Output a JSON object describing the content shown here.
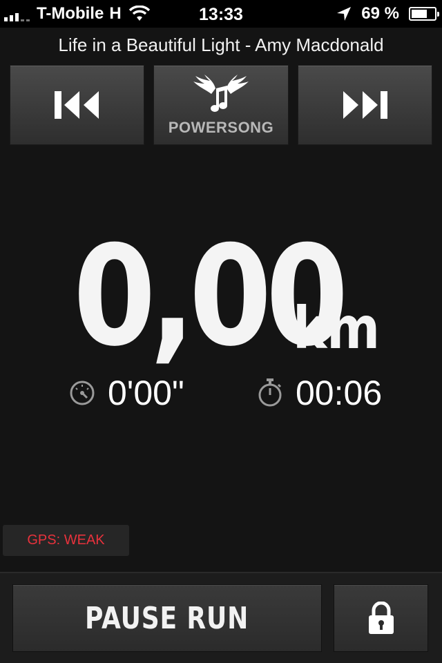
{
  "status_bar": {
    "carrier": "T-Mobile",
    "network": "H",
    "time": "13:33",
    "battery_percent": "69 %",
    "battery_level": 0.69
  },
  "now_playing": {
    "title": "Life in a Beautiful Light - Amy Macdonald"
  },
  "controls": {
    "powersong_label": "POWERSONG"
  },
  "run": {
    "distance_value": "0,00",
    "distance_unit": "km",
    "pace": "0'00\"",
    "duration": "00:06"
  },
  "gps": {
    "status_text": "GPS: WEAK",
    "status_color": "#e8323c"
  },
  "bottom": {
    "pause_label": "PAUSE RUN"
  }
}
